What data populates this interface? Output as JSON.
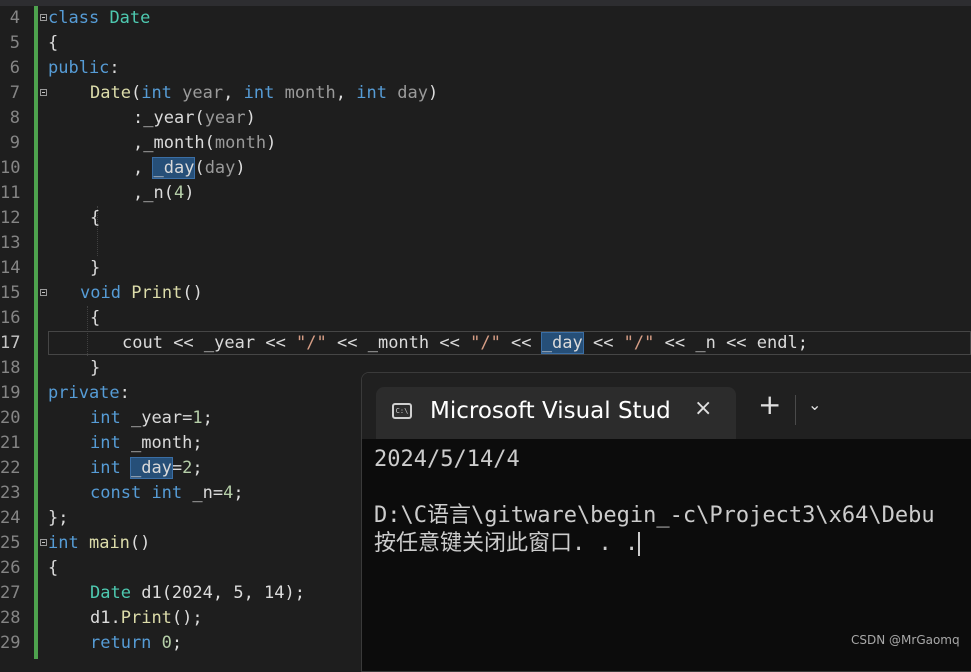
{
  "editor": {
    "line_numbers": [
      "4",
      "5",
      "6",
      "7",
      "8",
      "9",
      "10",
      "11",
      "12",
      "13",
      "14",
      "15",
      "16",
      "17",
      "18",
      "19",
      "20",
      "21",
      "22",
      "23",
      "24",
      "25",
      "26",
      "27",
      "28",
      "29"
    ],
    "tokens": {
      "class": "class",
      "Date": "Date",
      "lbrace": "{",
      "rbrace": "}",
      "rbrace_semi": "};",
      "public": "public",
      "colon": ":",
      "private": "private",
      "int": "int",
      "void": "void",
      "const": "const",
      "return": "return",
      "year": "year",
      "month": "month",
      "day": "day",
      "_year": "_year",
      "_month": "_month",
      "_day": "_day",
      "_n": "_n",
      "lparen": "(",
      "rparen": ")",
      "comma": ", ",
      "commasp": ",",
      "colon_init": ":",
      "four": "4",
      "Print": "Print",
      "parens": "()",
      "cout": "cout",
      "shl": " << ",
      "slash": "\"/\"",
      "endl": "endl",
      "semi": ";",
      "eq": "=",
      "one": "1",
      "two": "2",
      "main": "main",
      "d1": "d1",
      "args": "(2024, 5, 14)",
      "dot": ".",
      "zero": "0",
      "sp": " "
    }
  },
  "terminal": {
    "title": "Microsoft Visual Stud",
    "close_icon": "×",
    "new_tab_icon": "+",
    "dropdown_icon": "⌄",
    "app_icon": "C:\\",
    "output_line1": "2024/5/14/4",
    "output_line2": "D:\\C语言\\gitware\\begin_-c\\Project3\\x64\\Debu",
    "output_line3": "按任意键关闭此窗口. . ."
  },
  "watermark": "CSDN @MrGaomq"
}
